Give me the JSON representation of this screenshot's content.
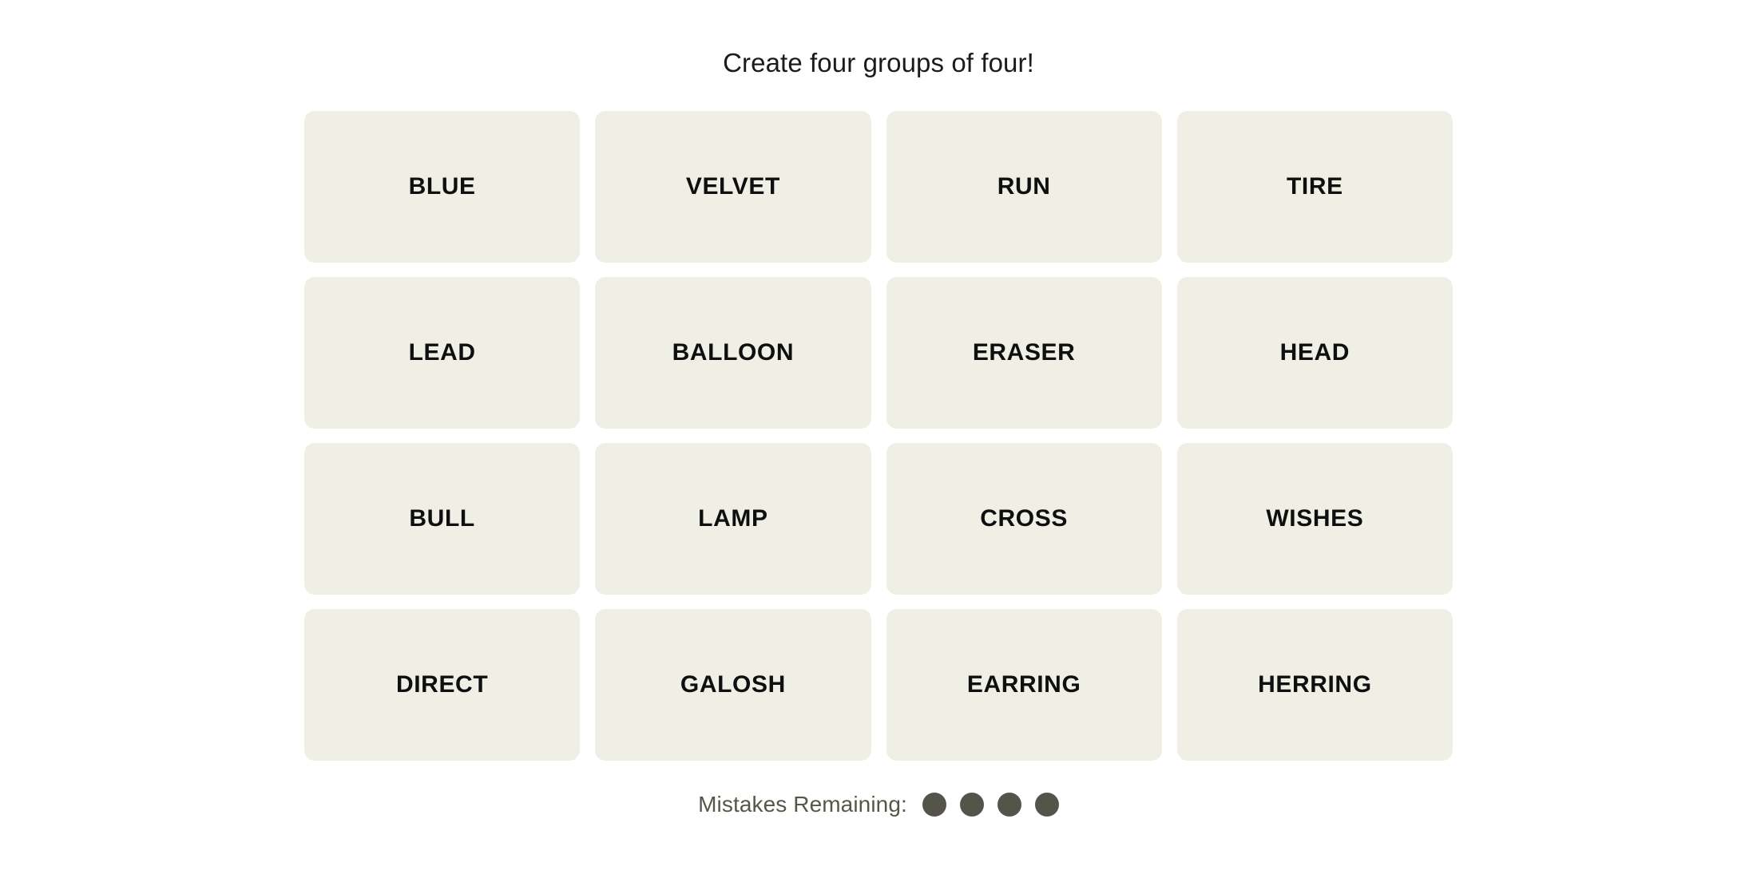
{
  "game": {
    "title": "Create four groups of four!",
    "tile_background": "#EFEFE6",
    "tile_text_color": "#100F0F",
    "page_background": "#FFFFFF"
  },
  "grid": {
    "rows": 4,
    "columns": 4,
    "tiles": [
      {
        "label": "BLUE"
      },
      {
        "label": "VELVET"
      },
      {
        "label": "RUN"
      },
      {
        "label": "TIRE"
      },
      {
        "label": "LEAD"
      },
      {
        "label": "BALLOON"
      },
      {
        "label": "ERASER"
      },
      {
        "label": "HEAD"
      },
      {
        "label": "BULL"
      },
      {
        "label": "LAMP"
      },
      {
        "label": "CROSS"
      },
      {
        "label": "WISHES"
      },
      {
        "label": "DIRECT"
      },
      {
        "label": "GALOSH"
      },
      {
        "label": "EARRING"
      },
      {
        "label": "HERRING"
      }
    ]
  },
  "mistakes": {
    "label": "Mistakes Remaining:",
    "remaining": 4,
    "total": 4,
    "dot_color": "#55544A",
    "label_color": "#57564B"
  }
}
